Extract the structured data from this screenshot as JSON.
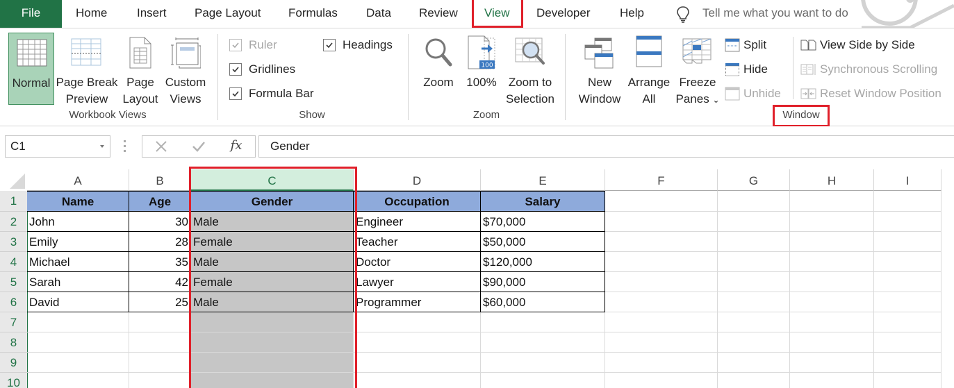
{
  "app": {
    "tabs": [
      {
        "label": "File"
      },
      {
        "label": "Home"
      },
      {
        "label": "Insert"
      },
      {
        "label": "Page Layout"
      },
      {
        "label": "Formulas"
      },
      {
        "label": "Data"
      },
      {
        "label": "Review"
      },
      {
        "label": "View"
      },
      {
        "label": "Developer"
      },
      {
        "label": "Help"
      }
    ],
    "active_tab": "View",
    "tell_me_placeholder": "Tell me what you want to do"
  },
  "ribbon": {
    "workbook_views": {
      "label": "Workbook Views",
      "buttons": [
        {
          "line1": "Normal",
          "line2": "",
          "selected": true
        },
        {
          "line1": "Page Break",
          "line2": "Preview"
        },
        {
          "line1": "Page",
          "line2": "Layout"
        },
        {
          "line1": "Custom",
          "line2": "Views"
        }
      ]
    },
    "show": {
      "label": "Show",
      "checkboxes": [
        {
          "label": "Ruler",
          "checked": true,
          "disabled": true
        },
        {
          "label": "Gridlines",
          "checked": true
        },
        {
          "label": "Formula Bar",
          "checked": true
        },
        {
          "label": "Headings",
          "checked": true
        }
      ]
    },
    "zoom": {
      "label": "Zoom",
      "buttons": [
        {
          "line1": "Zoom",
          "line2": ""
        },
        {
          "line1": "100%",
          "line2": "",
          "badge": "100"
        },
        {
          "line1": "Zoom to",
          "line2": "Selection"
        }
      ]
    },
    "window": {
      "label": "Window",
      "buttons": [
        {
          "line1": "New",
          "line2": "Window"
        },
        {
          "line1": "Arrange",
          "line2": "All"
        },
        {
          "line1": "Freeze",
          "line2": "Panes"
        }
      ],
      "small": [
        {
          "label": "Split"
        },
        {
          "label": "Hide"
        },
        {
          "label": "Unhide",
          "disabled": true
        },
        {
          "label": "View Side by Side"
        },
        {
          "label": "Synchronous Scrolling",
          "disabled": true
        },
        {
          "label": "Reset Window Position",
          "disabled": true
        }
      ]
    }
  },
  "formula_bar": {
    "name_box": "C1",
    "fx": "fx",
    "value": "Gender"
  },
  "sheet": {
    "columns": [
      "A",
      "B",
      "C",
      "D",
      "E",
      "F",
      "G",
      "H",
      "I"
    ],
    "selected_column": "C",
    "rows": [
      "1",
      "2",
      "3",
      "4",
      "5",
      "6",
      "7",
      "8",
      "9",
      "10"
    ],
    "headers": [
      "Name",
      "Age",
      "Gender",
      "Occupation",
      "Salary"
    ],
    "data": [
      [
        "John",
        "30",
        "Male",
        "Engineer",
        "$70,000"
      ],
      [
        "Emily",
        "28",
        "Female",
        "Teacher",
        "$50,000"
      ],
      [
        "Michael",
        "35",
        "Male",
        "Doctor",
        "$120,000"
      ],
      [
        "Sarah",
        "42",
        "Female",
        "Lawyer",
        "$90,000"
      ],
      [
        "David",
        "25",
        "Male",
        "Programmer",
        "$60,000"
      ]
    ]
  },
  "colors": {
    "excel_green": "#217346",
    "header_fill": "#8eaadb",
    "selection_gray": "#c6c6c6",
    "highlight_red": "#e0202a"
  }
}
